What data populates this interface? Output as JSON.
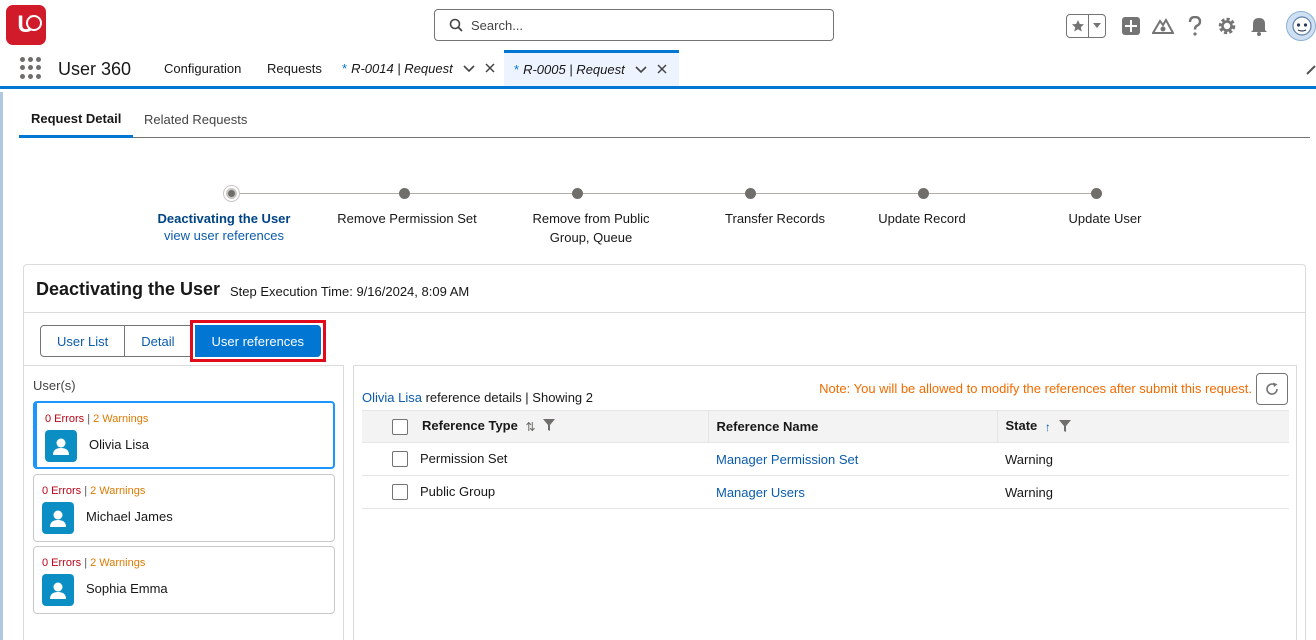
{
  "header": {
    "logo_text": "U",
    "search_placeholder": "Search..."
  },
  "nav": {
    "app_name": "User 360",
    "items": [
      "Configuration",
      "Requests"
    ],
    "tabs": [
      {
        "star": "*",
        "label": "R-0014 | Request",
        "active": false
      },
      {
        "star": "*",
        "label": "R-0005 | Request",
        "active": true
      }
    ]
  },
  "subtabs": [
    "Request Detail",
    "Related Requests"
  ],
  "path": {
    "steps": [
      "Deactivating the User",
      "Remove Permission Set",
      "Remove from Public Group, Queue",
      "Transfer Records",
      "Update Record",
      "Update User"
    ],
    "current_step": 0,
    "current_link": "view user references"
  },
  "card": {
    "title": "Deactivating the User",
    "subtitle": "Step Execution Time: 9/16/2024, 8:09 AM",
    "buttons": [
      "User List",
      "Detail",
      "User references"
    ],
    "active_button": "User references"
  },
  "users": {
    "title": "User(s)",
    "list": [
      {
        "errors": "0 Errors",
        "sep": "|",
        "warnings": "2 Warnings",
        "name": "Olivia Lisa",
        "selected": true
      },
      {
        "errors": "0 Errors",
        "sep": "|",
        "warnings": "2 Warnings",
        "name": "Michael James",
        "selected": false
      },
      {
        "errors": "0 Errors",
        "sep": "|",
        "warnings": "2 Warnings",
        "name": "Sophia Emma",
        "selected": false
      }
    ]
  },
  "references": {
    "user_link": "Olivia Lisa",
    "title_rest": " reference details | Showing 2",
    "note": "Note: You will be allowed to modify the references after submit this request.",
    "columns": [
      "Reference Type",
      "Reference Name",
      "State"
    ],
    "rows": [
      {
        "type": "Permission Set",
        "name": "Manager Permission Set",
        "state": "Warning"
      },
      {
        "type": "Public Group",
        "name": "Manager Users",
        "state": "Warning"
      }
    ]
  }
}
